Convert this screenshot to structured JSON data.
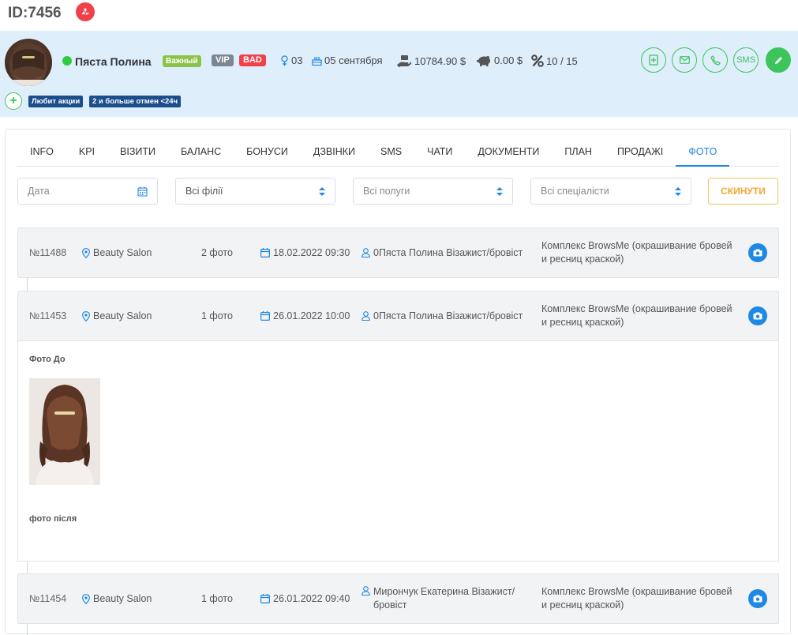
{
  "page": {
    "id_label": "ID:7456"
  },
  "client": {
    "name": "Пяста Полина",
    "tags": {
      "important": "Важный",
      "vip": "VIP",
      "bad": "BAD"
    },
    "stats": {
      "gender_value": "03",
      "birthday": "05 сентября",
      "balance": "10784.90 $",
      "deposit": "0.00 $",
      "discount": "10 / 15"
    },
    "actions": {
      "sms_label": "SMS"
    },
    "chips": [
      "Любит акции",
      "2 и больше отмен <24ч"
    ],
    "status_color": "#2ecc40"
  },
  "tabs": [
    "INFO",
    "KPI",
    "ВІЗИТИ",
    "БАЛАНС",
    "БОНУСИ",
    "ДЗВІНКИ",
    "SMS",
    "ЧАТИ",
    "ДОКУМЕНТИ",
    "ПЛАН",
    "ПРОДАЖІ",
    "ФОТО"
  ],
  "active_tab": "ФОТО",
  "filters": {
    "date_placeholder": "Дата",
    "branches": "Всі філії",
    "genders": "Всі полуги",
    "specialists": "Всі спеціалісти",
    "reset_label": "СКИНУТИ"
  },
  "visits": [
    {
      "number": "№11488",
      "salon": "Beauty Salon",
      "photo_count": "2 фото",
      "datetime": "18.02.2022 09:30",
      "master": "0Пяста Полина Візажист/бровіст",
      "service": "Комплекс BrowsMe (окрашивание бровей и ресниц краской)"
    },
    {
      "number": "№11453",
      "salon": "Beauty Salon",
      "photo_count": "1 фото",
      "datetime": "26.01.2022 10:00",
      "master": "0Пяста Полина Візажист/бровіст",
      "service": "Комплекс BrowsMe (окрашивание бровей и ресниц краской)",
      "expanded": true,
      "before_label": "Фото До",
      "after_label": "фото після"
    },
    {
      "number": "№11454",
      "salon": "Beauty Salon",
      "photo_count": "1 фото",
      "datetime": "26.01.2022 09:40",
      "master": "Мирончук Екатерина Візажист/бровіст",
      "service": "Комплекс BrowsMe (окрашивание бровей и ресниц краской)"
    }
  ],
  "colors": {
    "accent_blue": "#1e88e5",
    "accent_green": "#3cc55a",
    "danger_red": "#f0414b",
    "reset_orange": "#f0a830",
    "chip_navy": "#1c4e8c",
    "band_bg": "#deeefb"
  },
  "icons": {
    "recycle": "recycle-icon",
    "gender": "female-symbol-icon",
    "birthday": "birthday-cake-icon",
    "balance": "money-hand-icon",
    "deposit": "piggy-bank-icon",
    "discount": "percent-icon",
    "calendar": "calendar-icon",
    "location": "map-pin-icon",
    "user": "user-icon",
    "camera": "camera-icon"
  }
}
